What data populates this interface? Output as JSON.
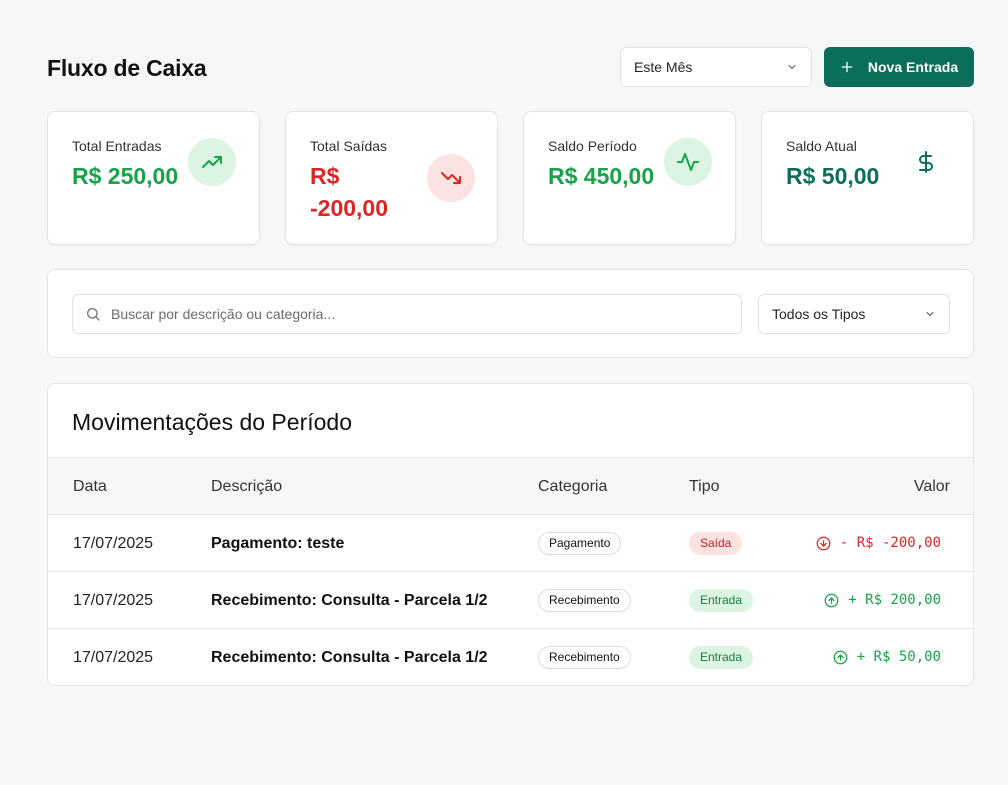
{
  "header": {
    "title": "Fluxo de Caixa",
    "period_select": "Este Mês",
    "new_button": "Nova Entrada"
  },
  "cards": [
    {
      "label": "Total Entradas",
      "value": "R$ 250,00",
      "icon": "trending-up-icon",
      "color": "#16a34a"
    },
    {
      "label": "Total Saídas",
      "value_line1": "R$",
      "value_line2": "-200,00",
      "icon": "trending-down-icon",
      "color": "#dc2626"
    },
    {
      "label": "Saldo Período",
      "value": "R$ 450,00",
      "icon": "activity-icon",
      "color": "#16a34a"
    },
    {
      "label": "Saldo Atual",
      "value": "R$ 50,00",
      "icon": "dollar-sign-icon",
      "color": "#0b6e5b"
    }
  ],
  "filters": {
    "search_placeholder": "Buscar por descrição ou categoria...",
    "type_select": "Todos os Tipos"
  },
  "table": {
    "title": "Movimentações do Período",
    "columns": [
      "Data",
      "Descrição",
      "Categoria",
      "Tipo",
      "Valor"
    ],
    "rows": [
      {
        "data": "17/07/2025",
        "descricao": "Pagamento: teste",
        "categoria": "Pagamento",
        "tipo": "Saída",
        "valor": "- R$ -200,00"
      },
      {
        "data": "17/07/2025",
        "descricao": "Recebimento: Consulta - Parcela 1/2",
        "categoria": "Recebimento",
        "tipo": "Entrada",
        "valor": "+ R$ 200,00"
      },
      {
        "data": "17/07/2025",
        "descricao": "Recebimento: Consulta - Parcela 1/2",
        "categoria": "Recebimento",
        "tipo": "Entrada",
        "valor": "+ R$ 50,00"
      }
    ]
  },
  "colors": {
    "brand": "#0b6e5b",
    "positive": "#16a34a",
    "negative": "#dc2626"
  }
}
